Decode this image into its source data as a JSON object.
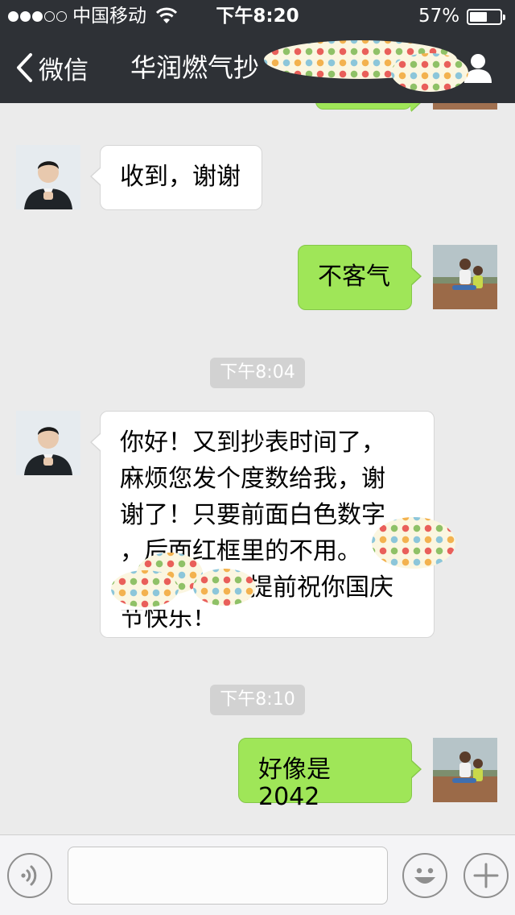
{
  "status_bar": {
    "signal_bars": 3,
    "signal_total": 5,
    "carrier": "中国移动",
    "time": "下午8:20",
    "battery_percent": "57%",
    "battery_level": 0.57
  },
  "nav": {
    "back_label": "微信",
    "title": "华润燃气抄",
    "back_icon": "chevron-left-icon",
    "profile_icon": "person-icon"
  },
  "messages": [
    {
      "type": "bubble",
      "side": "in",
      "text": "收到，谢谢"
    },
    {
      "type": "bubble",
      "side": "out",
      "text": "不客气"
    },
    {
      "type": "time",
      "text": "下午8:04"
    },
    {
      "type": "bubble",
      "side": "in",
      "lines": [
        "你好！又到抄表时间了，",
        "麻烦您发个度数给我，谢",
        "谢了！只要前面白色数字",
        "，后面红框里的不用。",
        "",
        "节快乐！"
      ],
      "partial": "提前祝你国庆"
    },
    {
      "type": "time",
      "text": "下午8:10"
    },
    {
      "type": "bubble",
      "side": "out",
      "text": "好像是2042"
    }
  ],
  "input_bar": {
    "value": "",
    "voice_icon": "voice-icon",
    "emoji_icon": "emoji-icon",
    "plus_icon": "plus-icon"
  },
  "colors": {
    "bar_background": "#2e3136",
    "chat_background": "#ebebeb",
    "outgoing_bubble": "#9fe658",
    "incoming_bubble": "#ffffff",
    "timestamp_background": "#d2d2d2"
  }
}
